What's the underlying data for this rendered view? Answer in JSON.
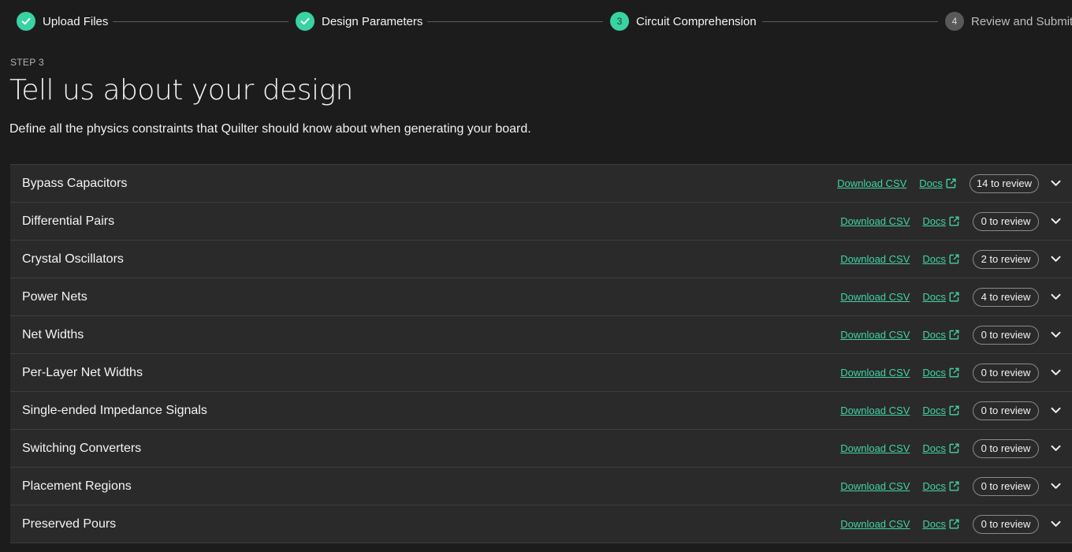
{
  "stepper": {
    "steps": [
      {
        "label": "Upload Files",
        "status": "done"
      },
      {
        "label": "Design Parameters",
        "status": "done"
      },
      {
        "label": "Circuit Comprehension",
        "status": "current",
        "number": "3"
      },
      {
        "label": "Review and Submit",
        "status": "todo",
        "number": "4"
      }
    ]
  },
  "header": {
    "eyebrow": "STEP 3",
    "title": "Tell us about your design",
    "subtitle": "Define all the physics constraints that Quilter should know about when generating your board."
  },
  "rows": [
    {
      "title": "Bypass Capacitors",
      "csv_label": "Download CSV",
      "docs_label": "Docs",
      "review": "14 to review"
    },
    {
      "title": "Differential Pairs",
      "csv_label": "Download CSV",
      "docs_label": "Docs",
      "review": "0 to review"
    },
    {
      "title": "Crystal Oscillators",
      "csv_label": "Download CSV",
      "docs_label": "Docs",
      "review": "2 to review"
    },
    {
      "title": "Power Nets",
      "csv_label": "Download CSV",
      "docs_label": "Docs",
      "review": "4 to review"
    },
    {
      "title": "Net Widths",
      "csv_label": "Download CSV",
      "docs_label": "Docs",
      "review": "0 to review"
    },
    {
      "title": "Per-Layer Net Widths",
      "csv_label": "Download CSV",
      "docs_label": "Docs",
      "review": "0 to review"
    },
    {
      "title": "Single-ended Impedance Signals",
      "csv_label": "Download CSV",
      "docs_label": "Docs",
      "review": "0 to review"
    },
    {
      "title": "Switching Converters",
      "csv_label": "Download CSV",
      "docs_label": "Docs",
      "review": "0 to review"
    },
    {
      "title": "Placement Regions",
      "csv_label": "Download CSV",
      "docs_label": "Docs",
      "review": "0 to review"
    },
    {
      "title": "Preserved Pours",
      "csv_label": "Download CSV",
      "docs_label": "Docs",
      "review": "0 to review"
    }
  ],
  "colors": {
    "accent": "#39d2a2",
    "background": "#1d1c1c",
    "row_background": "#2b2a2a"
  },
  "icons": {
    "done_step": "check-icon",
    "docs": "external-link-icon",
    "row_toggle": "chevron-down-icon"
  }
}
